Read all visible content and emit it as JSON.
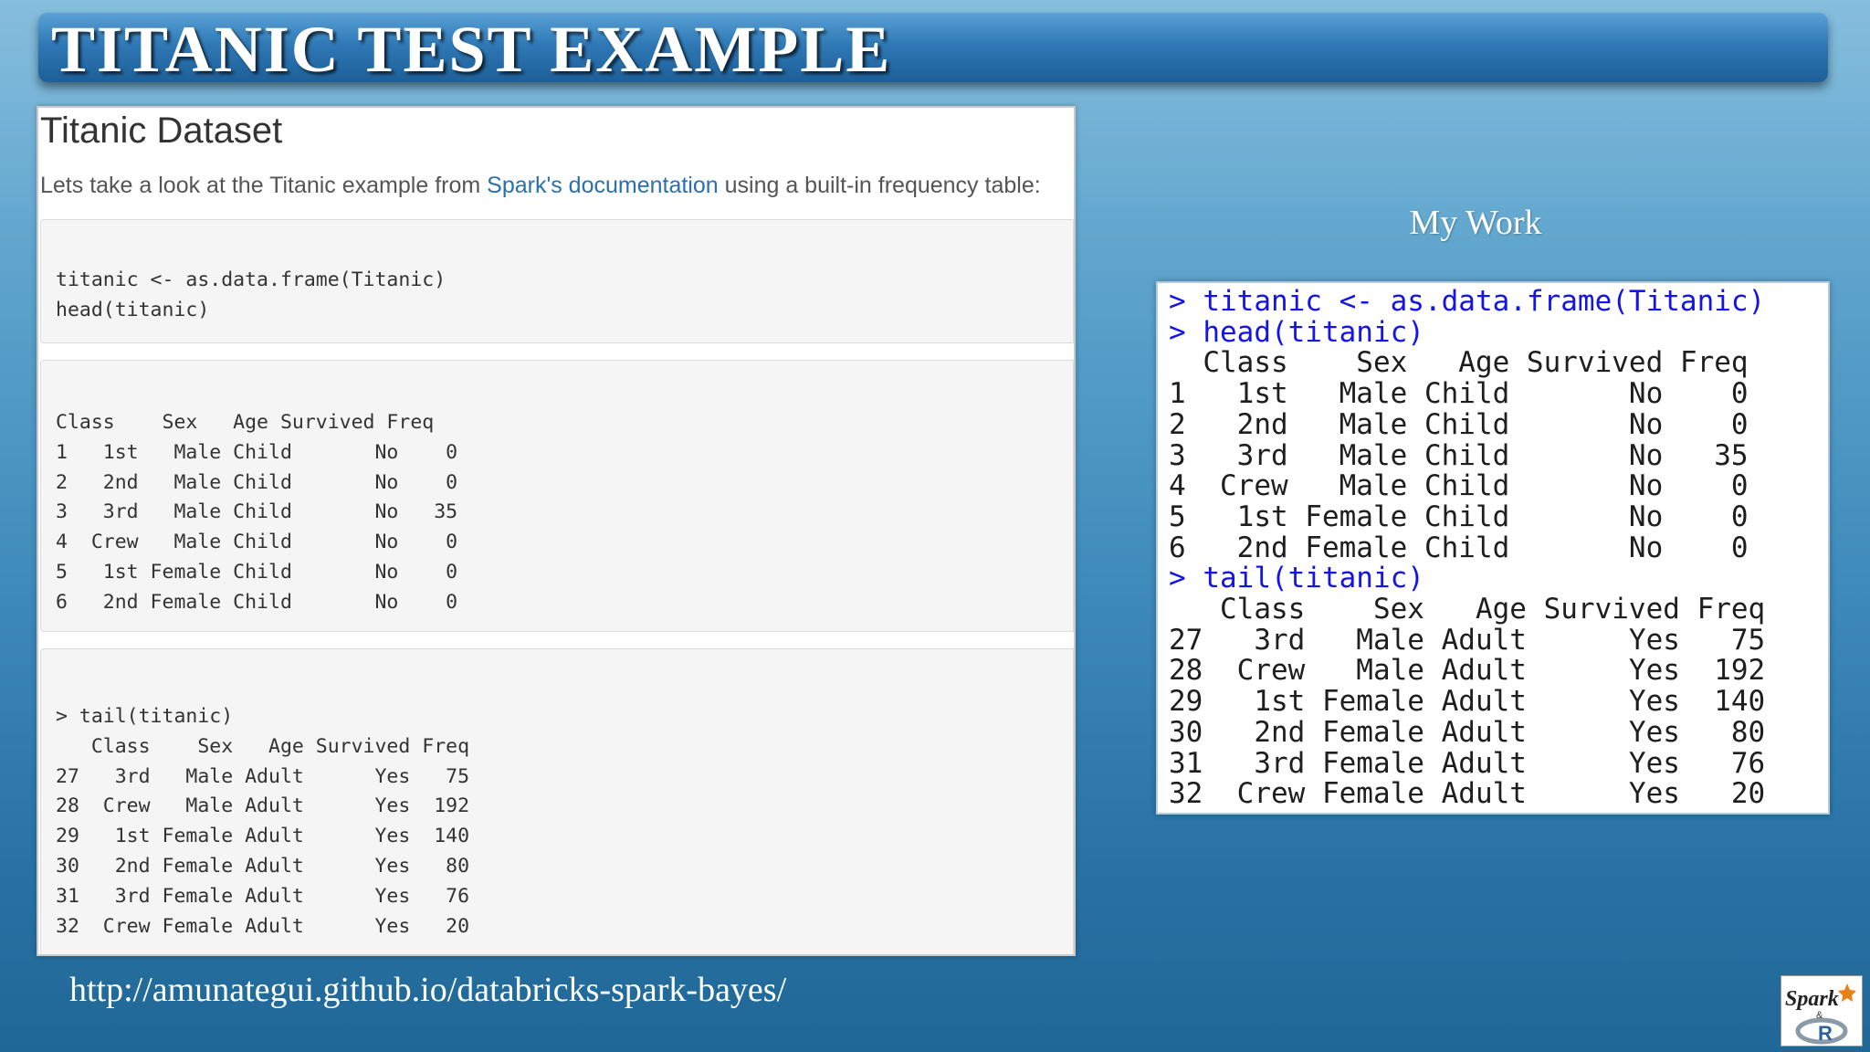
{
  "slide": {
    "title": "TITANIC TEST EXAMPLE",
    "url": "http://amunategui.github.io/databricks-spark-bayes/"
  },
  "left_panel": {
    "heading": "Titanic Dataset",
    "intro_before": "Lets take a look at the Titanic example from ",
    "intro_link": "Spark's documentation",
    "intro_after": " using a built-in frequency table:",
    "code_block": "titanic <- as.data.frame(Titanic)\nhead(titanic)",
    "head_output": "Class    Sex   Age Survived Freq\n1   1st   Male Child       No    0\n2   2nd   Male Child       No    0\n3   3rd   Male Child       No   35\n4  Crew   Male Child       No    0\n5   1st Female Child       No    0\n6   2nd Female Child       No    0",
    "tail_output": "> tail(titanic)\n   Class    Sex   Age Survived Freq\n27   3rd   Male Adult      Yes   75\n28  Crew   Male Adult      Yes  192\n29   1st Female Adult      Yes  140\n30   2nd Female Adult      Yes   80\n31   3rd Female Adult      Yes   76\n32  Crew Female Adult      Yes   20"
  },
  "right_panel": {
    "label": "My Work",
    "cmd_1": "> titanic <- as.data.frame(Titanic)\n> head(titanic)",
    "head_output": "  Class    Sex   Age Survived Freq\n1   1st   Male Child       No    0\n2   2nd   Male Child       No    0\n3   3rd   Male Child       No   35\n4  Crew   Male Child       No    0\n5   1st Female Child       No    0\n6   2nd Female Child       No    0",
    "cmd_2": "> tail(titanic)",
    "tail_output": "   Class    Sex   Age Survived Freq\n27   3rd   Male Adult      Yes   75\n28  Crew   Male Adult      Yes  192\n29   1st Female Adult      Yes  140\n30   2nd Female Adult      Yes   80\n31   3rd Female Adult      Yes   76\n32  Crew Female Adult      Yes   20"
  },
  "logo": {
    "icon": "spark-and-r-logo-icon",
    "text_top": "Spark",
    "text_mid": "&",
    "text_bottom": "R"
  }
}
